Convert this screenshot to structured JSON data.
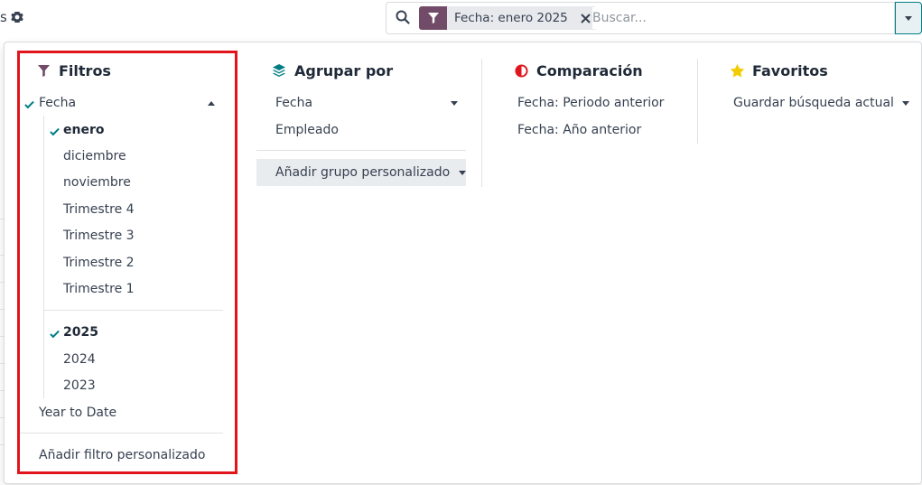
{
  "page": {
    "fragment": "s"
  },
  "search": {
    "facet_label": "Fecha: enero 2025",
    "placeholder": "Buscar..."
  },
  "icons": {
    "gear": "gear-icon",
    "search": "search-icon",
    "filter": "filter-icon",
    "close": "close-icon",
    "toggle": "caret-down-icon",
    "layers": "layers-icon",
    "comparison": "half-circle-icon",
    "star": "star-icon",
    "check": "check-icon"
  },
  "colors": {
    "brand": "#714b67",
    "teal": "#017e84",
    "red": "#e0161c",
    "star": "#f3cc00"
  },
  "filters": {
    "title": "Filtros",
    "fecha_label": "Fecha",
    "months": [
      "enero",
      "diciembre",
      "noviembre"
    ],
    "quarters": [
      "Trimestre 4",
      "Trimestre 3",
      "Trimestre 2",
      "Trimestre 1"
    ],
    "years": [
      "2025",
      "2024",
      "2023"
    ],
    "year_to_date": "Year to Date",
    "add_custom": "Añadir filtro personalizado"
  },
  "groupby": {
    "title": "Agrupar por",
    "items": [
      "Fecha",
      "Empleado"
    ],
    "add_custom": "Añadir grupo personalizado"
  },
  "comparison": {
    "title": "Comparación",
    "items": [
      "Fecha: Periodo anterior",
      "Fecha: Año anterior"
    ]
  },
  "favorites": {
    "title": "Favoritos",
    "save_search": "Guardar búsqueda actual"
  }
}
